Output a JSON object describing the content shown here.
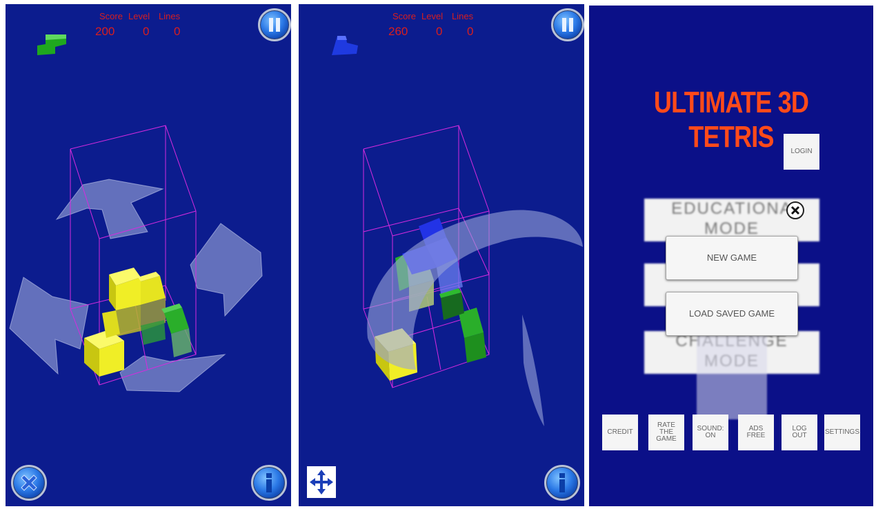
{
  "screens": [
    {
      "hud": {
        "score_label": "Score",
        "level_label": "Level",
        "lines_label": "Lines",
        "score": "200",
        "level": "0",
        "lines": "0"
      },
      "next_piece_color": "#1fa81f",
      "icons": [
        "pause-icon",
        "close-icon",
        "info-icon",
        "rotate-arrows-icon"
      ]
    },
    {
      "hud": {
        "score_label": "Score",
        "level_label": "Level",
        "lines_label": "Lines",
        "score": "260",
        "level": "0",
        "lines": "0"
      },
      "next_piece_color": "#1f3ae0",
      "icons": [
        "pause-icon",
        "move-arrows-icon",
        "info-icon",
        "rotate-curve-icon"
      ]
    },
    {
      "title": "ULTIMATE 3D TETRIS",
      "login": "LOGIN",
      "modes": {
        "educational_line1": "EDUCATIONA",
        "educational_line2": "MODE",
        "challenge_line1": "CHALLENGE",
        "challenge_line2": "MODE"
      },
      "dialog": {
        "new_game": "NEW GAME",
        "load_saved_game": "LOAD SAVED GAME"
      },
      "bottom": [
        {
          "line1": "CREDIT"
        },
        {
          "line1": "RATE",
          "line2": "THE",
          "line3": "GAME"
        },
        {
          "line1": "SOUND:",
          "line2": "ON"
        },
        {
          "line1": "ADS",
          "line2": "FREE"
        },
        {
          "line1": "LOG",
          "line2": "OUT"
        },
        {
          "line1": "SETTINGS"
        }
      ]
    }
  ],
  "colors": {
    "background": "#0c1c8e",
    "hud_text": "#d81e1e",
    "title": "#ff4a1a",
    "yellow_block": "#f0ee26",
    "green_block": "#2aae2a",
    "blue_block": "#2233e6",
    "frame": "#d82adf"
  }
}
